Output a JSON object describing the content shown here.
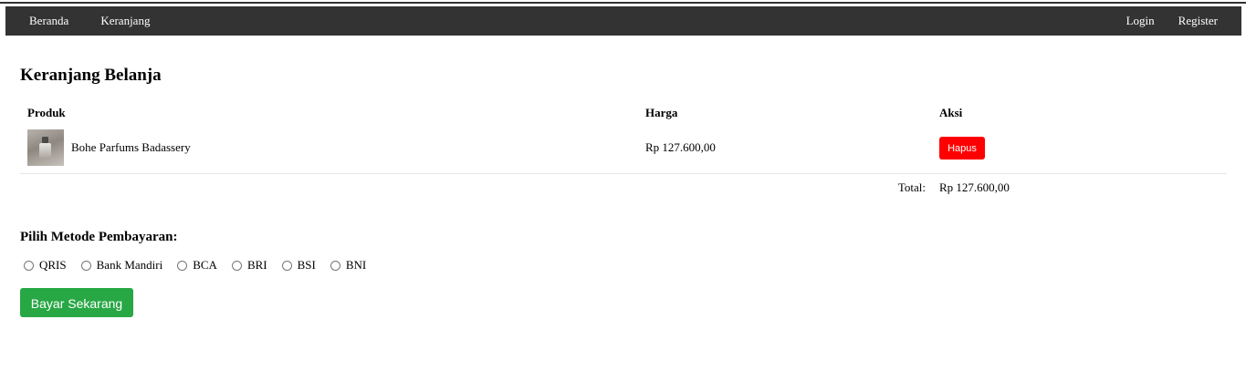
{
  "nav": {
    "left": [
      "Beranda",
      "Keranjang"
    ],
    "right": [
      "Login",
      "Register"
    ]
  },
  "page_title": "Keranjang Belanja",
  "table": {
    "headers": {
      "product": "Produk",
      "price": "Harga",
      "action": "Aksi"
    },
    "items": [
      {
        "name": "Bohe Parfums Badassery",
        "price": "Rp 127.600,00",
        "action_label": "Hapus"
      }
    ],
    "total_label": "Total:",
    "total_value": "Rp 127.600,00"
  },
  "payment": {
    "heading": "Pilih Metode Pembayaran:",
    "methods": [
      "QRIS",
      "Bank Mandiri",
      "BCA",
      "BRI",
      "BSI",
      "BNI"
    ],
    "pay_button": "Bayar Sekarang"
  },
  "colors": {
    "navbar": "#333333",
    "delete_button": "#ff0000",
    "pay_button": "#28a745"
  }
}
